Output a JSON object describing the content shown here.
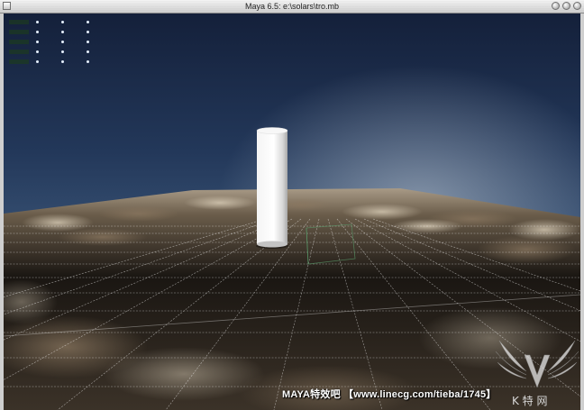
{
  "window": {
    "title": "Maya 6.5: e:\\solars\\tro.mb"
  },
  "viewport": {
    "sky_top": "#14203a",
    "sky_horizon": "#4a6688",
    "grid_color": "#ffffff",
    "ground_color": "#6b5a45",
    "object": "cylinder"
  },
  "hud": {
    "rows": 5,
    "columns": 3
  },
  "overlay": {
    "watermark_text": "MAYA特效吧 【www.linecg.com/tieba/1745】",
    "logo_caption": "K 特 网"
  }
}
